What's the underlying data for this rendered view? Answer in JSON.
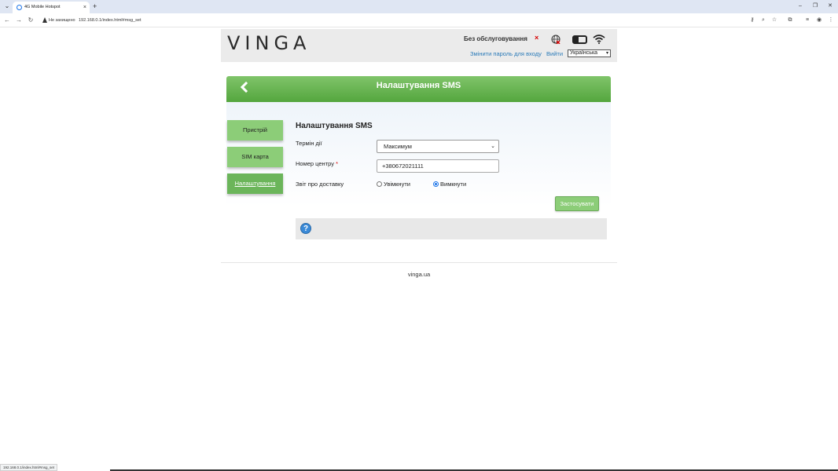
{
  "browser": {
    "tab_title": "4G Mobile Hotspot",
    "tab_close": "×",
    "new_tab": "+",
    "not_secure": "Не захищено",
    "url": "192.168.0.1/index.html#msg_set",
    "status_url": "192.168.0.1/index.html#msg_set"
  },
  "header": {
    "logo": "VINGA",
    "network_status": "Без обслуговування",
    "status_mark": "×",
    "change_password": "Змінити пароль для входу",
    "logout": "Вийти",
    "language": "Українська"
  },
  "banner": {
    "title": "Налаштування SMS"
  },
  "sidebar": {
    "items": [
      {
        "label": "Пристрій"
      },
      {
        "label": "SIM карта"
      },
      {
        "label": "Налаштування"
      }
    ]
  },
  "form": {
    "title": "Налаштування SMS",
    "validity_label": "Термін дії",
    "validity_value": "Максимум",
    "center_label": "Номер центру",
    "required_mark": "*",
    "center_value": "+380672021111",
    "report_label": "Звіт про доставку",
    "report_on": "Увімкнути",
    "report_off": "Вимкнути",
    "report_selected": "off",
    "apply": "Застосувати"
  },
  "help": {
    "icon": "?"
  },
  "footer": {
    "text": "vinga.ua"
  }
}
